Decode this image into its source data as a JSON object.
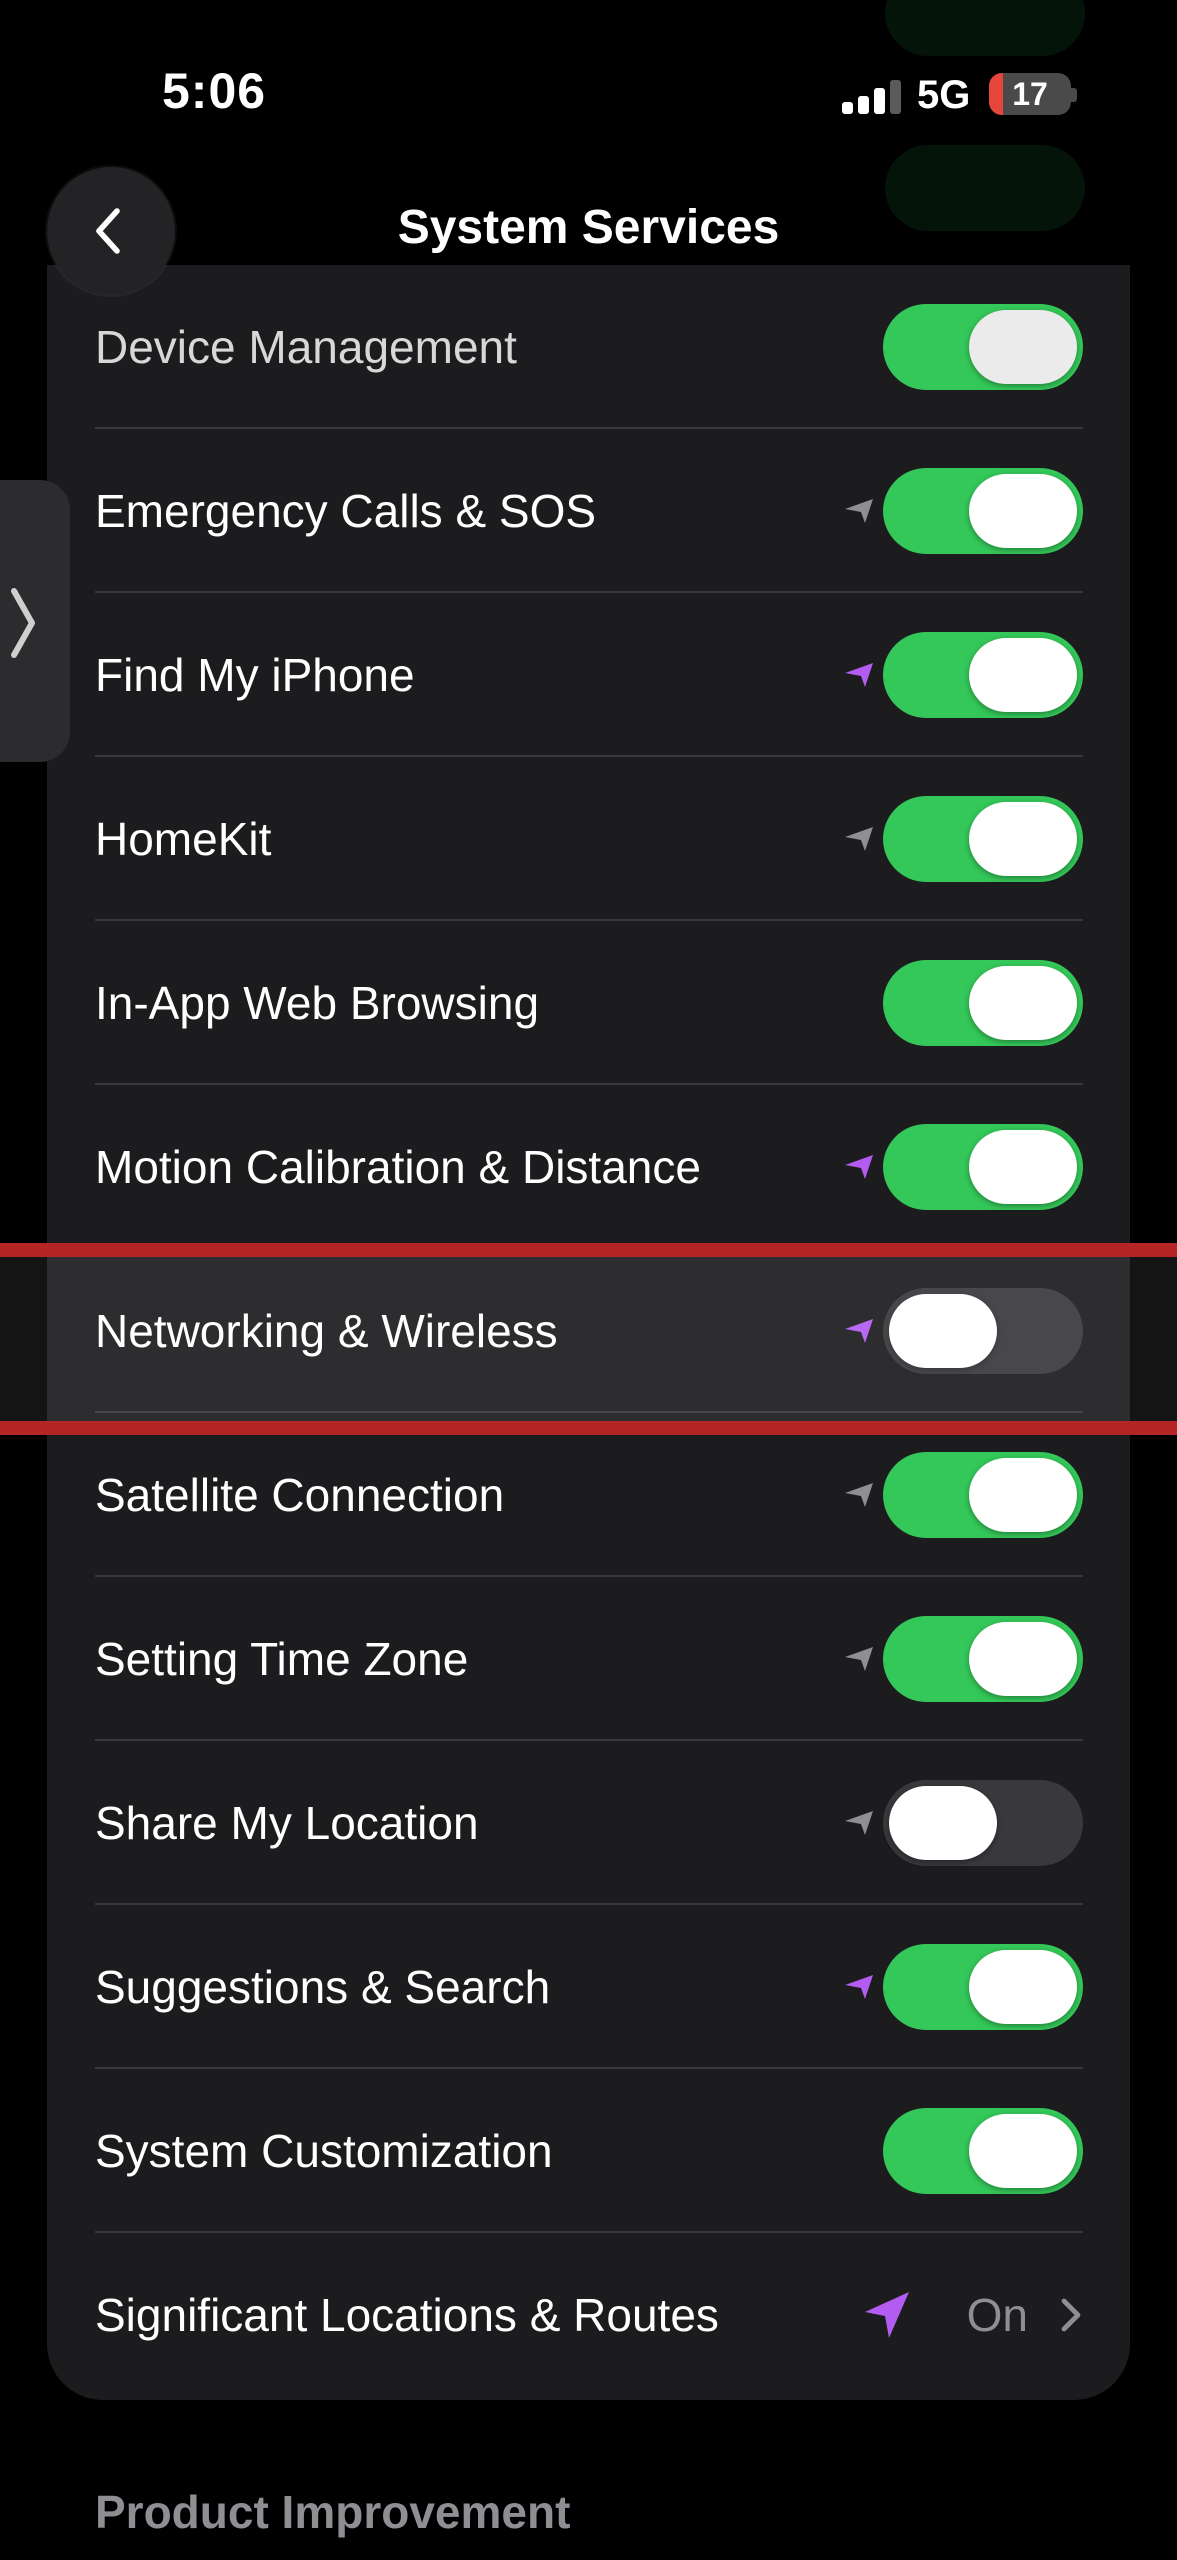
{
  "status_bar": {
    "time": "5:06",
    "network": "5G",
    "battery": "17",
    "battery_level": 0.17
  },
  "header": {
    "title": "System Services"
  },
  "rows": [
    {
      "label": "Device Management",
      "on": true
    },
    {
      "label": "Emergency Calls & SOS",
      "on": true,
      "arrow": "gray"
    },
    {
      "label": "Find My iPhone",
      "on": true,
      "arrow": "purple"
    },
    {
      "label": "HomeKit",
      "on": true,
      "arrow": "gray"
    },
    {
      "label": "In-App Web Browsing",
      "on": true
    },
    {
      "label": "Motion Calibration & Distance",
      "on": true,
      "arrow": "purple"
    },
    {
      "label": "Networking & Wireless",
      "on": false,
      "arrow": "purple",
      "highlighted": true
    },
    {
      "label": "Satellite Connection",
      "on": true,
      "arrow": "gray"
    },
    {
      "label": "Setting Time Zone",
      "on": true,
      "arrow": "gray"
    },
    {
      "label": "Share My Location",
      "on": false,
      "arrow": "gray"
    },
    {
      "label": "Suggestions & Search",
      "on": true,
      "arrow": "purple"
    },
    {
      "label": "System Customization",
      "on": true
    }
  ],
  "significant_locations": {
    "label": "Significant Locations & Routes",
    "value": "On"
  },
  "section_footer": "Product Improvement",
  "colors": {
    "toggle_on": "#34c759",
    "toggle_off": "#39393d",
    "arrow_purple": "#b35cf2",
    "arrow_gray": "#8e8e93",
    "highlight": "#b52525"
  }
}
